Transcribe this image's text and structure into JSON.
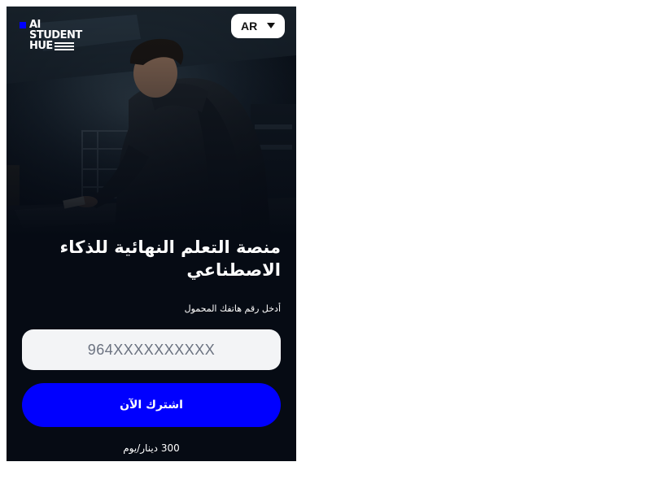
{
  "colors": {
    "page_background": "#ffffff",
    "app_background": "#060b14",
    "accent": "#0000ff",
    "input_background": "#f3f4f6",
    "text_primary": "#ffffff"
  },
  "header": {
    "logo": {
      "line1": "AI",
      "line2": "STUDENT",
      "line3": "HUE"
    },
    "language": {
      "selected": "AR",
      "icon": "caret-down-icon"
    }
  },
  "hero": {
    "image": "man-in-dark-jacket-looking-down"
  },
  "main": {
    "title": "منصة التعلم النهائية للذكاء الاصطناعي",
    "phone_label": "أدخل رقم هاتفك المحمول",
    "phone_input": {
      "value": "",
      "placeholder": "964XXXXXXXXXX"
    },
    "subscribe_button": "اشترك الآن",
    "price": "300 دينار/يوم"
  }
}
